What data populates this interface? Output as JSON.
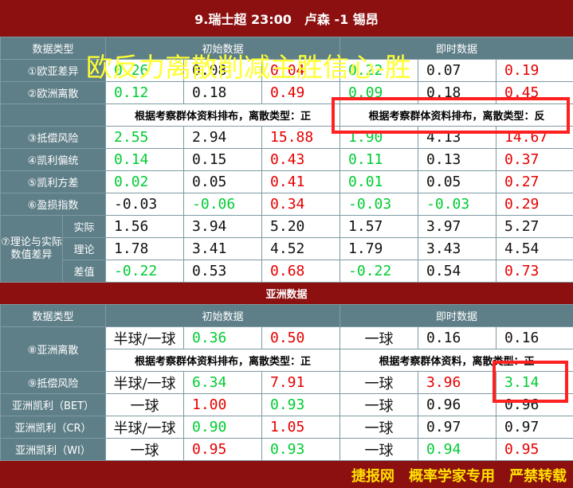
{
  "title": "9.瑞士超 23:00　卢森 -1 锡昂",
  "overlay": "欧反力离散削减主胜信心-胜",
  "euro": {
    "header": [
      "数据类型",
      "初始数据",
      "即时数据"
    ],
    "rows": [
      {
        "label": "①欧亚差异",
        "cells": [
          {
            "v": "0.26",
            "c": "green"
          },
          {
            "v": "0.08",
            "c": "dark"
          },
          {
            "v": "0.04",
            "c": "red"
          },
          {
            "v": "0.22",
            "c": "green"
          },
          {
            "v": "0.07",
            "c": "dark"
          },
          {
            "v": "0.19",
            "c": "red"
          }
        ]
      },
      {
        "label": "②欧洲离散",
        "cells": [
          {
            "v": "0.12",
            "c": "green"
          },
          {
            "v": "0.18",
            "c": "dark"
          },
          {
            "v": "0.49",
            "c": "red"
          },
          {
            "v": "0.09",
            "c": "green"
          },
          {
            "v": "0.18",
            "c": "dark"
          },
          {
            "v": "0.45",
            "c": "red"
          }
        ]
      },
      {
        "label": "③抵偿风险",
        "cells": [
          {
            "v": "2.55",
            "c": "green"
          },
          {
            "v": "2.94",
            "c": "dark"
          },
          {
            "v": "15.88",
            "c": "red"
          },
          {
            "v": "1.90",
            "c": "green"
          },
          {
            "v": "4.13",
            "c": "dark"
          },
          {
            "v": "14.67",
            "c": "red"
          }
        ]
      },
      {
        "label": "④凯利偏统",
        "cells": [
          {
            "v": "0.14",
            "c": "green"
          },
          {
            "v": "0.15",
            "c": "dark"
          },
          {
            "v": "0.43",
            "c": "red"
          },
          {
            "v": "0.11",
            "c": "green"
          },
          {
            "v": "0.13",
            "c": "dark"
          },
          {
            "v": "0.37",
            "c": "red"
          }
        ]
      },
      {
        "label": "⑤凯利方差",
        "cells": [
          {
            "v": "0.02",
            "c": "green"
          },
          {
            "v": "0.05",
            "c": "dark"
          },
          {
            "v": "0.41",
            "c": "red"
          },
          {
            "v": "0.01",
            "c": "green"
          },
          {
            "v": "0.05",
            "c": "dark"
          },
          {
            "v": "0.27",
            "c": "red"
          }
        ]
      },
      {
        "label": "⑥盈损指数",
        "cells": [
          {
            "v": "-0.03",
            "c": "dark"
          },
          {
            "v": "-0.06",
            "c": "green"
          },
          {
            "v": "0.34",
            "c": "red"
          },
          {
            "v": "-0.03",
            "c": "green"
          },
          {
            "v": "-0.03",
            "c": "green"
          },
          {
            "v": "0.29",
            "c": "red"
          }
        ]
      }
    ],
    "note_initial": "根据考察群体资料排布，离散类型：正",
    "note_live": "根据考察群体资料排布，离散类型：反",
    "theory_label": "⑦理论与实际数值差异",
    "theory_rows": [
      {
        "sub": "实际",
        "cells": [
          {
            "v": "1.56",
            "c": "dark"
          },
          {
            "v": "3.94",
            "c": "dark"
          },
          {
            "v": "5.20",
            "c": "dark"
          },
          {
            "v": "1.57",
            "c": "dark"
          },
          {
            "v": "3.97",
            "c": "dark"
          },
          {
            "v": "5.27",
            "c": "dark"
          }
        ]
      },
      {
        "sub": "理论",
        "cells": [
          {
            "v": "1.78",
            "c": "dark"
          },
          {
            "v": "3.41",
            "c": "dark"
          },
          {
            "v": "4.52",
            "c": "dark"
          },
          {
            "v": "1.79",
            "c": "dark"
          },
          {
            "v": "3.43",
            "c": "dark"
          },
          {
            "v": "4.54",
            "c": "dark"
          }
        ]
      },
      {
        "sub": "差值",
        "cells": [
          {
            "v": "-0.22",
            "c": "green"
          },
          {
            "v": "0.53",
            "c": "dark"
          },
          {
            "v": "0.68",
            "c": "red"
          },
          {
            "v": "-0.22",
            "c": "green"
          },
          {
            "v": "0.54",
            "c": "dark"
          },
          {
            "v": "0.73",
            "c": "red"
          }
        ]
      }
    ]
  },
  "asia": {
    "bar_title": "亚洲数据",
    "header": [
      "数据类型",
      "初始数据",
      "即时数据"
    ],
    "asia_label": "⑧亚洲离散",
    "asia_row": {
      "h1": "半球/一球",
      "c1": {
        "v": "0.36",
        "c": "green"
      },
      "c2": {
        "v": "0.50",
        "c": "red"
      },
      "h2": "一球",
      "c3": {
        "v": "0.16",
        "c": "dark"
      },
      "c4": {
        "v": "0.16",
        "c": "dark"
      }
    },
    "note_initial": "根据考察群体资料排布，离散类型：正",
    "note_live": "根据考察群体资料，离散类型：正",
    "rows": [
      {
        "label": "⑨抵偿风险",
        "h1": "半球/一球",
        "c1": {
          "v": "6.34",
          "c": "green"
        },
        "c2": {
          "v": "7.91",
          "c": "red"
        },
        "h2": "一球",
        "c3": {
          "v": "3.96",
          "c": "red"
        },
        "c4": {
          "v": "3.14",
          "c": "green"
        }
      },
      {
        "label": "亚洲凯利（BET）",
        "h1": "一球",
        "c1": {
          "v": "1.00",
          "c": "red"
        },
        "c2": {
          "v": "0.93",
          "c": "green"
        },
        "h2": "一球",
        "c3": {
          "v": "0.96",
          "c": "dark"
        },
        "c4": {
          "v": "0.96",
          "c": "dark"
        }
      },
      {
        "label": "亚洲凯利（CR）",
        "h1": "半球/一球",
        "c1": {
          "v": "0.90",
          "c": "green"
        },
        "c2": {
          "v": "1.05",
          "c": "red"
        },
        "h2": "一球",
        "c3": {
          "v": "0.97",
          "c": "dark"
        },
        "c4": {
          "v": "0.97",
          "c": "dark"
        }
      },
      {
        "label": "亚洲凯利（WI）",
        "h1": "一球",
        "c1": {
          "v": "0.95",
          "c": "red"
        },
        "c2": {
          "v": "0.93",
          "c": "green"
        },
        "h2": "一球",
        "c3": {
          "v": "0.94",
          "c": "green"
        },
        "c4": {
          "v": "0.95",
          "c": "red"
        }
      }
    ]
  },
  "footer": "捷报网　概率学家专用　严禁转载"
}
